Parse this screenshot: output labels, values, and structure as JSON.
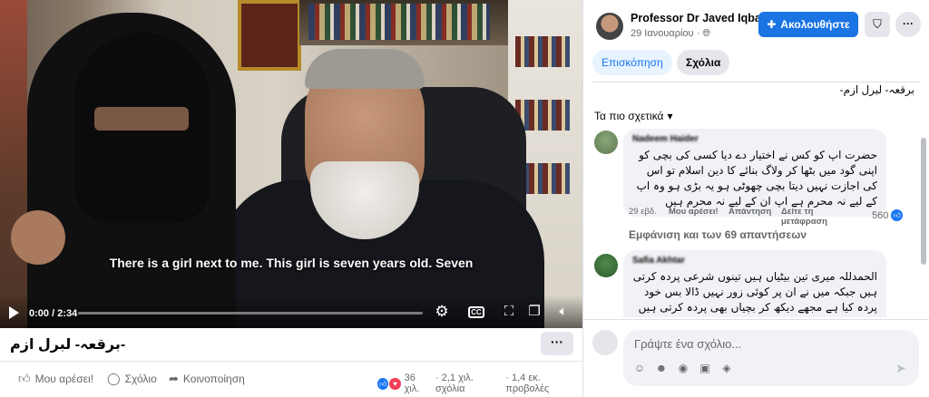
{
  "video": {
    "subtitle": "There is a girl next to me. This girl is seven years old. Seven",
    "time": "0:00 / 2:34",
    "progress": 0.0,
    "cc_label": "CC",
    "icons": [
      "play-icon",
      "gear-icon",
      "cc-icon",
      "expand-icon",
      "pip-icon",
      "volume-icon"
    ]
  },
  "post": {
    "title": "برقعہ- لبرل ازم-",
    "more_label": "···",
    "actions": {
      "like": "Μου αρέσει!",
      "comment": "Σχόλιο",
      "share": "Κοινοποίηση"
    },
    "stats": {
      "reactions": "36 χιλ.",
      "comments": "· 2,1 χιλ. σχόλια",
      "views": "· 1,4 εκ. προβολές"
    }
  },
  "panel": {
    "author": "Professor Dr Javed Iqbal",
    "date": "29 Ιανουαρίου ·",
    "follow_label": "Ακολουθήστε",
    "more_label": "···",
    "tabs": {
      "overview": "Επισκόπηση",
      "comments": "Σχόλια"
    },
    "repeat_title": "برقعہ- لبرل ازم-",
    "sort_label": "Τα πιο σχετικά"
  },
  "comments": [
    {
      "name": "Nadeem Haider",
      "text": "حضرت اپ کو کس نے اختیار دے دیا کسی کی بچی کو اپنی گود میں بٹھا کر ولاگ بنائے کا دین اسلام تو اس کی اجازت نہیں دیتا بچی چھوٹی ہو یہ بڑی ہو وہ اپ کے لیے نہ محرم ہے اپ ان کے لیے نہ محرم ہیں",
      "time": "29 εβδ.",
      "like": "Μου αρέσει!",
      "reply": "Απάντηση",
      "translate": "Δείτε τη μετάφραση",
      "likes": "560",
      "replies": "Εμφάνιση και των 69 απαντήσεων"
    },
    {
      "name": "Safia Akhtar",
      "text": "الحمدللہ میری تین بیٹیاں ہیں تینوں شرعی پردہ کرتی ہیں جبکہ میں نے ان پر کوئی زور نہیں ڈالا بس خود پردہ کیا ہے مجھے دیکھ کر بچیاں بھی پردہ کرتی ہیں بڑی بیٹی شادی کے بعد بھی پردہ کرتی ہے"
    }
  ],
  "composer": {
    "placeholder": "Γράψτε ένα σχόλιο..."
  },
  "colors": {
    "accent": "#1b74e4",
    "tab_active_bg": "#e7f3ff",
    "bubble_bg": "#f0f2f5",
    "secondary_text": "#65676b"
  }
}
